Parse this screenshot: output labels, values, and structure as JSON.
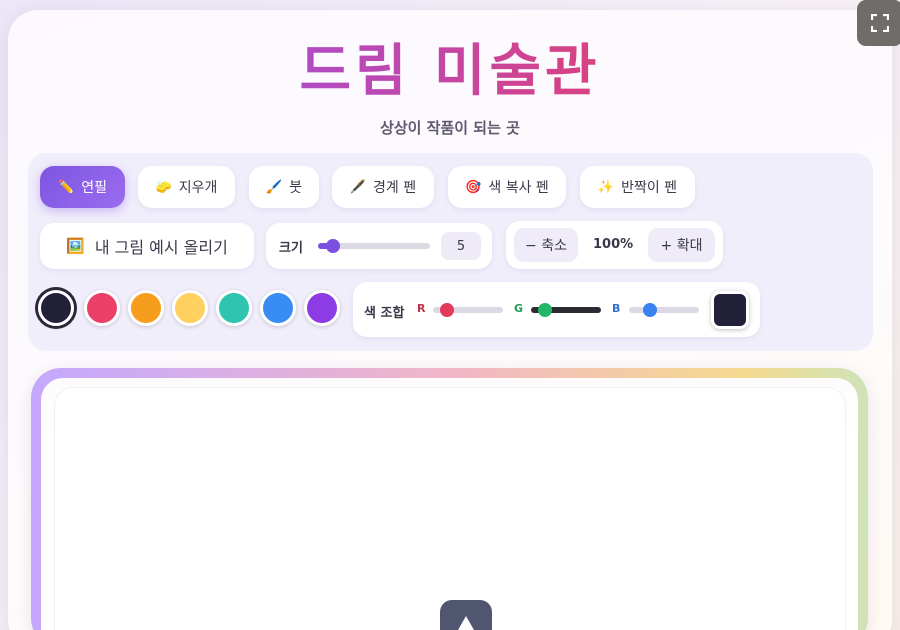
{
  "header": {
    "title": "드림 미술관",
    "subtitle": "상상이 작품이 되는 곳"
  },
  "tools": [
    {
      "label": "연필",
      "icon": "pencil-icon",
      "glyph": "✏️",
      "active": true
    },
    {
      "label": "지우개",
      "icon": "sponge-icon",
      "glyph": "🧽",
      "active": false
    },
    {
      "label": "붓",
      "icon": "paintbrush-icon",
      "glyph": "🖌️",
      "active": false
    },
    {
      "label": "경계 펜",
      "icon": "pen-icon",
      "glyph": "🖋️",
      "active": false
    },
    {
      "label": "색 복사 펜",
      "icon": "target-icon",
      "glyph": "🎯",
      "active": false
    },
    {
      "label": "반짝이 펜",
      "icon": "sparkles-icon",
      "glyph": "✨",
      "active": false
    }
  ],
  "upload": {
    "label": "내 그림 예시 올리기",
    "icon": "picture-icon",
    "glyph": "🖼️"
  },
  "size": {
    "label": "크기",
    "value": "5",
    "level": 0.1
  },
  "zoom": {
    "out_label": "− 축소",
    "value": "100%",
    "in_label": "+ 확대"
  },
  "palette": {
    "colors": [
      "#22213a",
      "#ec4068",
      "#f79d1d",
      "#fdd060",
      "#2ec4b0",
      "#3a8cf5",
      "#8d3be5"
    ],
    "selected_index": 0
  },
  "mixer": {
    "label": "색 조합",
    "r": {
      "label": "R",
      "value": 34,
      "color": "#e23a58"
    },
    "g": {
      "label": "G",
      "value": 33,
      "color": "#23b769"
    },
    "b": {
      "label": "B",
      "value": 58,
      "color": "#3a82f0"
    },
    "preview_color": "#22213a"
  }
}
